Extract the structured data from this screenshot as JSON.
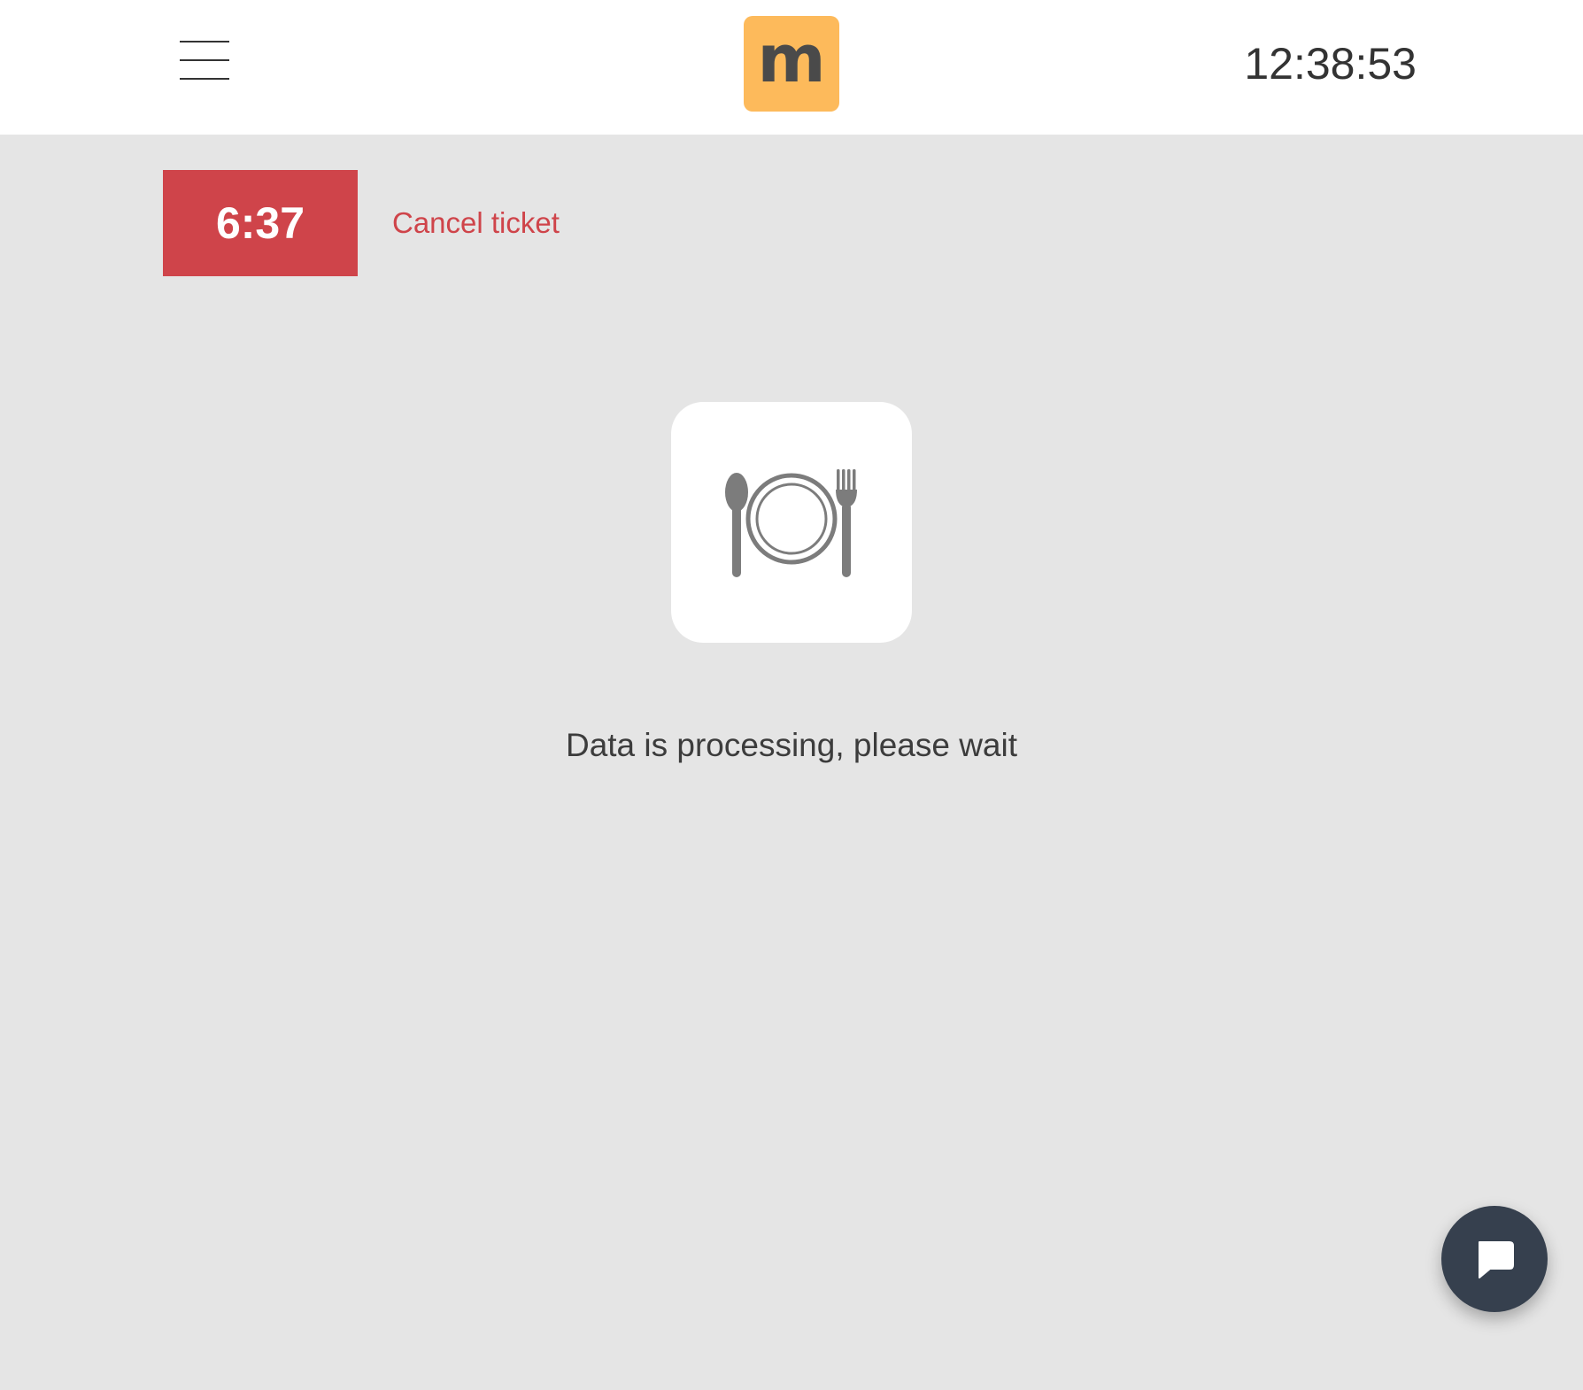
{
  "header": {
    "menu_icon": "hamburger-menu-icon",
    "logo_letter": "m",
    "logo_color": "#fdba5b",
    "clock": "12:38:53"
  },
  "ticket": {
    "timer": "6:37",
    "timer_color": "#cf444a",
    "cancel_label": "Cancel ticket"
  },
  "status": {
    "icon": "plate-cutlery-icon",
    "message": "Data is processing, please wait"
  },
  "chat": {
    "icon": "chat-bubble-icon"
  }
}
